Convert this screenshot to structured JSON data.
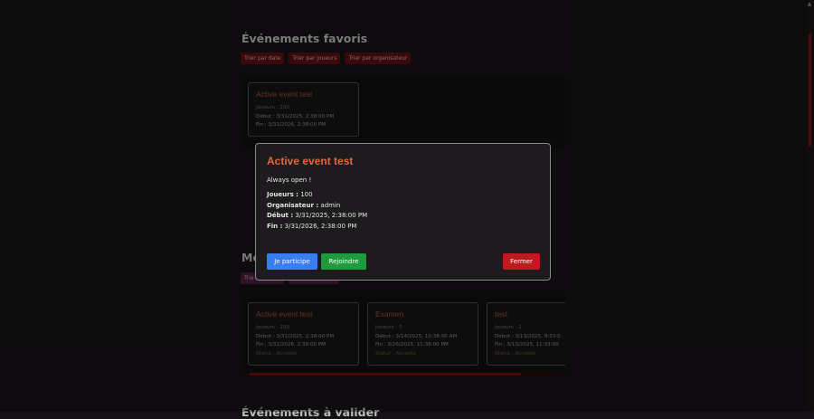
{
  "favorites": {
    "title": "Événements favoris",
    "sort_buttons": [
      "Trier par date",
      "Trier par joueurs",
      "Trier par organisateur"
    ],
    "cards": [
      {
        "title": "Active event test",
        "players": "Joueurs : 100",
        "start": "Début : 3/31/2025, 2:38:00 PM",
        "end": "Fin : 3/31/2026, 2:38:00 PM"
      }
    ]
  },
  "my_events": {
    "title_fragment": "Mo",
    "sort_button_fragment": "Trie",
    "cards": [
      {
        "title": "Active event test",
        "players": "Joueurs : 100",
        "start": "Début : 3/31/2025, 2:38:00 PM",
        "end": "Fin : 3/31/2026, 2:38:00 PM",
        "status": "Statut : Accepté"
      },
      {
        "title": "Examen",
        "players": "Joueurs : 5",
        "start": "Début : 3/14/2025, 10:38:00 AM",
        "end": "Fin : 3/26/2025, 11:38:00 PM",
        "status": "Statut : Accepté"
      },
      {
        "title": "test",
        "players": "Joueurs : 2",
        "start": "Début : 3/13/2025, 9:33:0",
        "end": "Fin : 3/13/2025, 11:33:00",
        "status": "Statut : Accepté"
      }
    ]
  },
  "next_section": {
    "title_fragment": "Événements à valider"
  },
  "modal": {
    "title": "Active event test",
    "description": "Always open !",
    "fields": [
      {
        "label": "Joueurs :",
        "value": "100"
      },
      {
        "label": "Organisateur :",
        "value": "admin"
      },
      {
        "label": "Début :",
        "value": "3/31/2025, 2:38:00 PM"
      },
      {
        "label": "Fin :",
        "value": "3/31/2026, 2:38:00 PM"
      }
    ],
    "buttons": {
      "participate": "Je participe",
      "join": "Rejoindre",
      "close": "Fermer"
    }
  },
  "colors": {
    "accent_red": "#c0191f",
    "participate_blue": "#3a7df0",
    "join_green": "#1f9a3c",
    "title_orange": "#e2683c"
  }
}
